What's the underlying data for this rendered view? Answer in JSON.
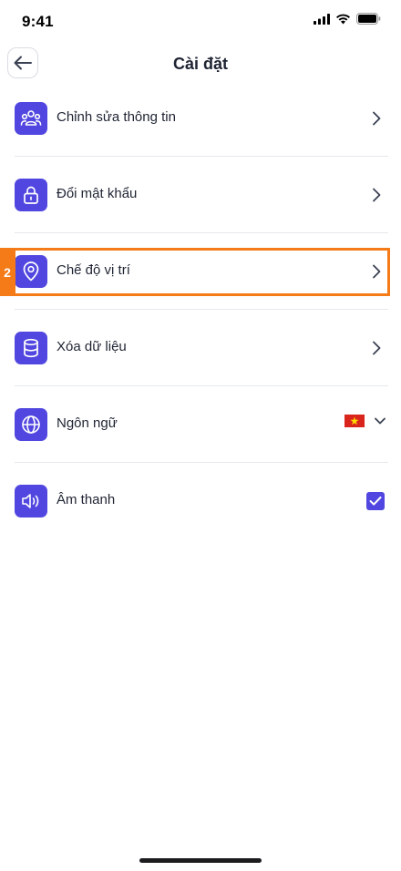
{
  "status_bar": {
    "time": "9:41"
  },
  "header": {
    "title": "Cài đặt",
    "back_icon": "arrow-left-icon"
  },
  "settings": {
    "items": [
      {
        "label": "Chỉnh sửa thông tin",
        "icon": "users-icon",
        "trailing": "chevron-right-icon"
      },
      {
        "label": "Đổi mật khẩu",
        "icon": "lock-icon",
        "trailing": "chevron-right-icon"
      },
      {
        "label": "Chế độ vị trí",
        "icon": "location-pin-icon",
        "trailing": "chevron-right-icon"
      },
      {
        "label": "Xóa dữ liệu",
        "icon": "database-icon",
        "trailing": "chevron-right-icon"
      },
      {
        "label": "Ngôn ngữ",
        "icon": "globe-icon",
        "trailing": "chevron-down-icon",
        "selected_language_flag": "vietnam-flag-icon"
      },
      {
        "label": "Âm thanh",
        "icon": "speaker-icon",
        "trailing": "checkbox",
        "checked": true
      }
    ]
  },
  "annotation": {
    "tag": "2"
  },
  "colors": {
    "accent": "#5147e0",
    "highlight": "#f57a18",
    "divider": "#e6e8ee",
    "text": "#1f2433"
  }
}
